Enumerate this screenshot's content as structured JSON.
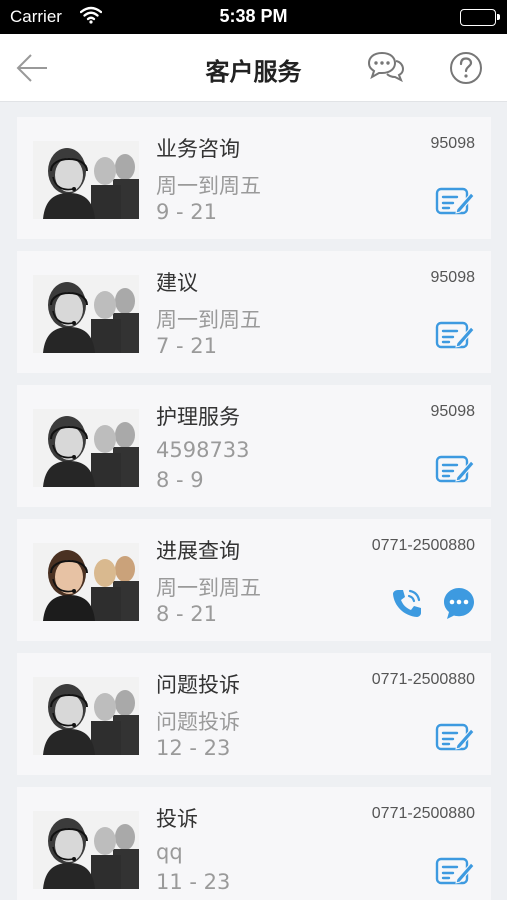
{
  "status_bar": {
    "carrier": "Carrier",
    "time": "5:38 PM"
  },
  "nav": {
    "title": "客户服务"
  },
  "services": [
    {
      "name": "业务咨询",
      "phone": "95098",
      "line1": "周一到周五",
      "line2": "9 - 21",
      "action": "edit",
      "photo_tone": "gray"
    },
    {
      "name": "建议",
      "phone": "95098",
      "line1": "周一到周五",
      "line2": "7 - 21",
      "action": "edit",
      "photo_tone": "gray"
    },
    {
      "name": "护理服务",
      "phone": "95098",
      "line1": "4598733",
      "line2": "8 - 9",
      "action": "edit",
      "photo_tone": "gray"
    },
    {
      "name": "进展查询",
      "phone": "0771-2500880",
      "line1": "周一到周五",
      "line2": "8 - 21",
      "action": "call-chat",
      "photo_tone": "color"
    },
    {
      "name": "问题投诉",
      "phone": "0771-2500880",
      "line1": "问题投诉",
      "line2": "12 - 23",
      "action": "edit",
      "photo_tone": "gray"
    },
    {
      "name": "投诉",
      "phone": "0771-2500880",
      "line1": "qq",
      "line2": "11 - 23",
      "action": "edit",
      "photo_tone": "gray"
    }
  ],
  "colors": {
    "accent": "#3d9ae0",
    "background": "#eef0f3",
    "card": "#f7f7f9"
  },
  "icons": {
    "back": "back-arrow-icon",
    "chat": "chat-bubbles-icon",
    "help": "help-icon",
    "edit": "edit-form-icon",
    "phone": "phone-icon",
    "message": "message-icon"
  }
}
